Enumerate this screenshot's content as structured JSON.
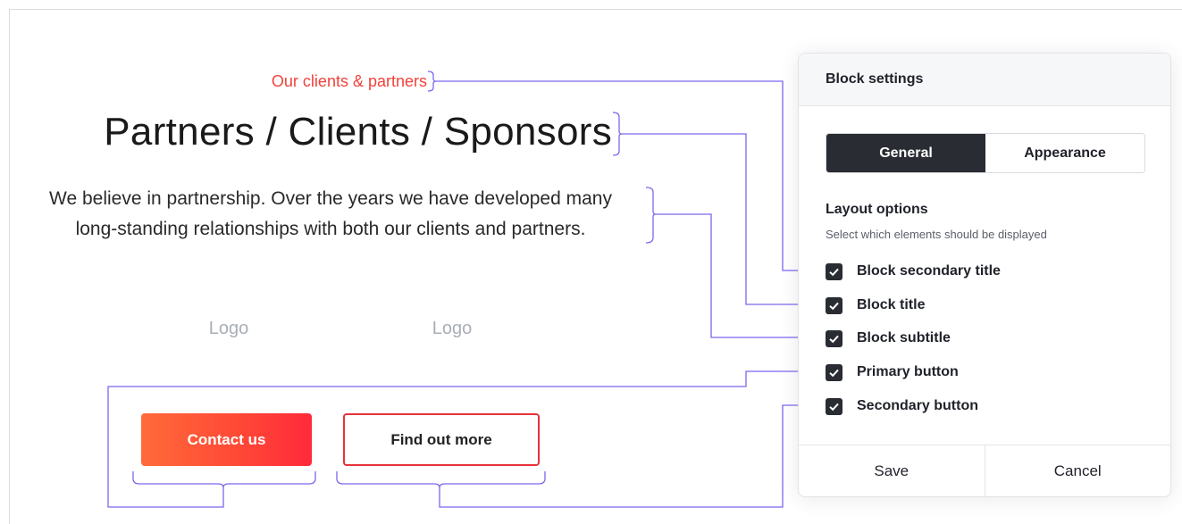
{
  "preview": {
    "secondary_title": "Our clients & partners",
    "title": "Partners / Clients / Sponsors",
    "subtitle_line1": "We believe in partnership. Over the years we have developed many",
    "subtitle_line2": "long-standing relationships with both our clients and partners.",
    "logos": [
      "Logo",
      "Logo"
    ],
    "primary_button": "Contact us",
    "secondary_button": "Find out more"
  },
  "panel": {
    "title": "Block settings",
    "tabs": [
      {
        "label": "General",
        "active": true
      },
      {
        "label": "Appearance",
        "active": false
      }
    ],
    "section_title": "Layout options",
    "section_description": "Select which elements should be displayed",
    "options": [
      {
        "label": "Block secondary title",
        "checked": true
      },
      {
        "label": "Block title",
        "checked": true
      },
      {
        "label": "Block subtitle",
        "checked": true
      },
      {
        "label": "Primary button",
        "checked": true
      },
      {
        "label": "Secondary button",
        "checked": true
      }
    ],
    "save_label": "Save",
    "cancel_label": "Cancel"
  },
  "colors": {
    "accent_red": "#f2423a",
    "connector": "#7b68ee",
    "dark": "#2a2c33"
  }
}
